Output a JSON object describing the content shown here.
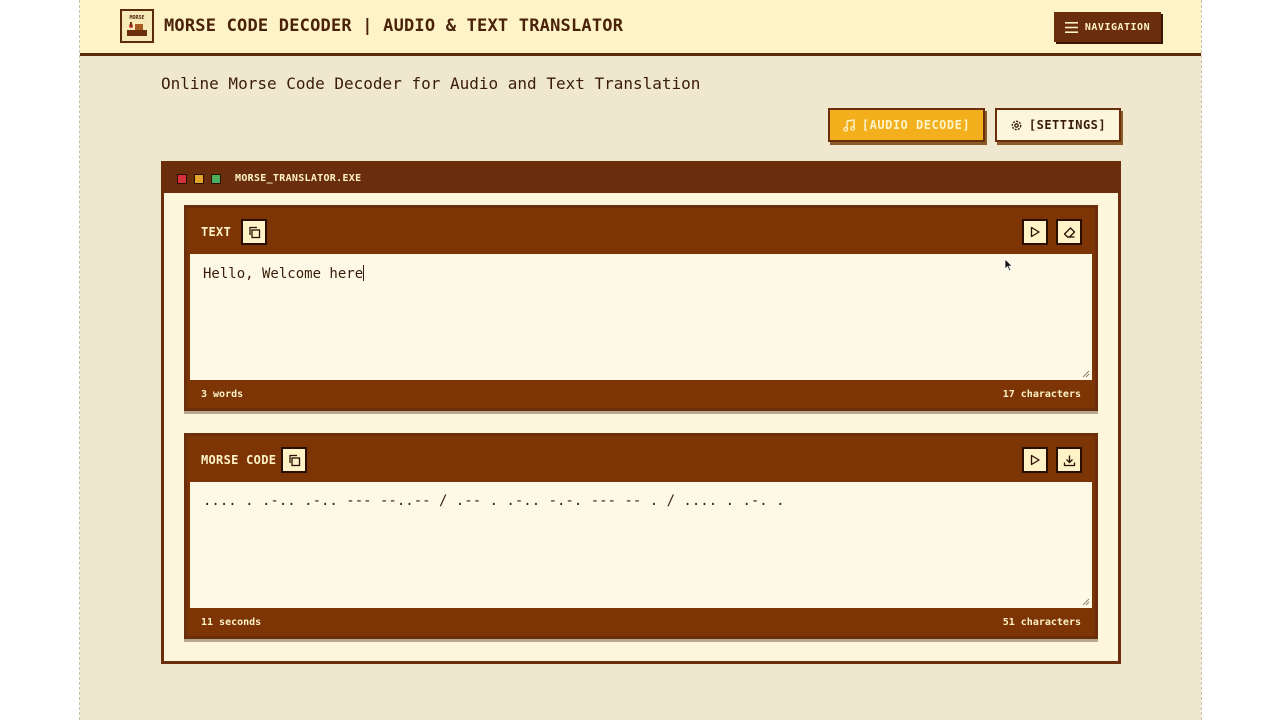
{
  "header": {
    "title": "MORSE CODE DECODER | AUDIO & TEXT TRANSLATOR",
    "logo_text": "MORSE",
    "nav_label": "NAVIGATION"
  },
  "subtitle": "Online Morse Code Decoder for Audio and Text Translation",
  "actions": {
    "audio_label": "[AUDIO DECODE]",
    "settings_label": "[SETTINGS]"
  },
  "window": {
    "title": "MORSE_TRANSLATOR.EXE"
  },
  "text_panel": {
    "label": "TEXT",
    "value": "Hello, Welcome here",
    "words": "3 words",
    "characters": "17 characters"
  },
  "morse_panel": {
    "label": "MORSE CODE",
    "value": ".... . .-.. .-.. --- --..-- / .-- . .-.. -.-. --- -- . / .... . .-. .",
    "duration": "11 seconds",
    "characters": "51 characters"
  },
  "colors": {
    "brown": "#6b2e0d",
    "panel_brown": "#7d3506",
    "accent_yellow": "#f3b01c",
    "cream": "#fdf6dd"
  }
}
